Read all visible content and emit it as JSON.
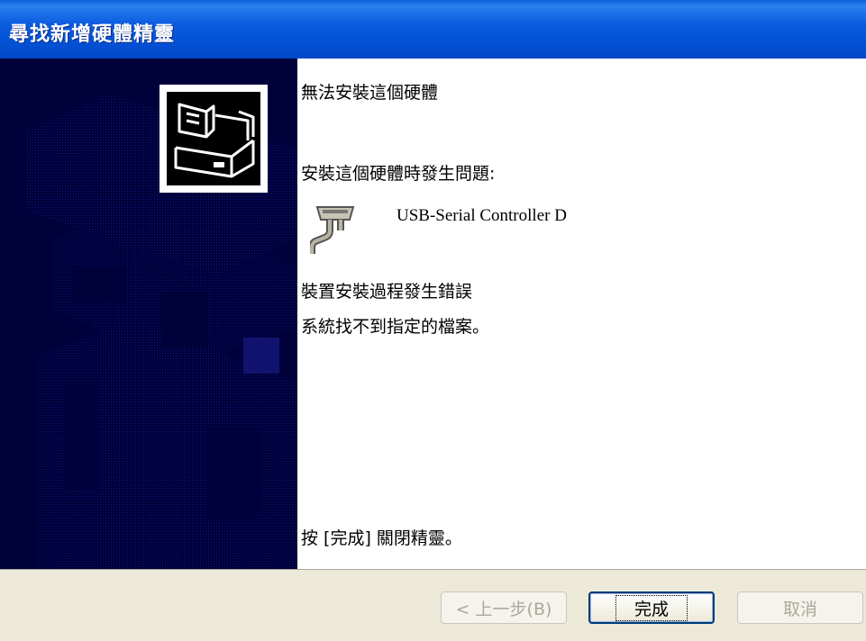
{
  "window": {
    "title": "尋找新增硬體精靈"
  },
  "content": {
    "heading": "無法安裝這個硬體",
    "problem_label": "安裝這個硬體時發生問題:",
    "device_name": "USB-Serial Controller D",
    "error_title": "裝置安裝過程發生錯誤",
    "error_detail": "系統找不到指定的檔案。",
    "finish_hint": "按 [完成] 關閉精靈。"
  },
  "buttons": {
    "back_label": "< 上一步(B)",
    "finish_label": "完成",
    "cancel_label": "取消"
  }
}
